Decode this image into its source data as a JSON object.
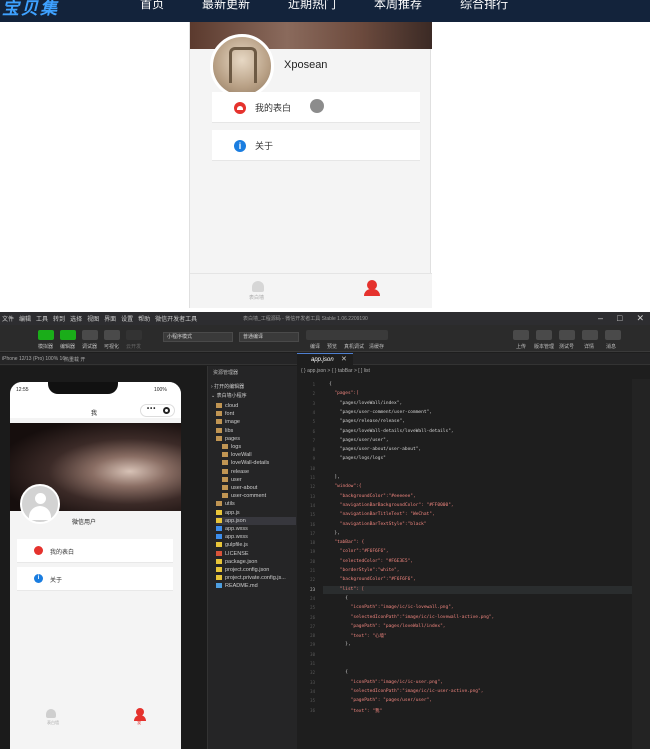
{
  "site": {
    "brand": "宝贝集",
    "nav": [
      "首页",
      "最新更新",
      "近期热门",
      "本周推荐",
      "综合排行"
    ]
  },
  "preview": {
    "username": "Xposean",
    "menu": [
      {
        "label": "我的表白",
        "icon": "heart-icon"
      },
      {
        "label": "关于",
        "icon": "info-icon"
      }
    ],
    "tabs": [
      {
        "label": "表白墙",
        "icon": "heart-tab-icon"
      },
      {
        "label": "我",
        "icon": "user-tab-icon"
      }
    ]
  },
  "devtools": {
    "menu": [
      "文件",
      "编辑",
      "工具",
      "转到",
      "选择",
      "视图",
      "界面",
      "设置",
      "帮助",
      "微信开发者工具"
    ],
    "window_title": "表白墙_工程源码 - 微信开发者工具 Stable 1.06.2209190",
    "toolbar": {
      "left_labels": [
        "模拟器",
        "编辑器",
        "调试器",
        "可视化",
        "云开发"
      ],
      "mode_select": "小程序模式",
      "compile_select": "普通编译",
      "mid_labels": [
        "编译",
        "预览",
        "真机调试",
        "清缓存"
      ],
      "right_labels": [
        "上传",
        "版本管理",
        "测试号",
        "详情",
        "消息"
      ]
    },
    "sub": {
      "device": "iPhone 12/13 (Pro) 100% 16",
      "network": "热重载 开"
    },
    "file_tab": "app.json",
    "breadcrumb": "{ } app.json > { } tabBar > [ ] list",
    "simulator": {
      "time": "12:55",
      "battery": "100%",
      "nav_title": "我",
      "username": "微信用户",
      "menu": [
        "我的表白",
        "关于"
      ],
      "tabs": [
        "表白墙",
        "我"
      ]
    },
    "explorer": {
      "title": "资源管理器",
      "open_editors": "打开的编辑器",
      "project": "表白墙小程序",
      "items": [
        {
          "label": "cloud",
          "depth": 1,
          "kind": "folder"
        },
        {
          "label": "font",
          "depth": 1,
          "kind": "folder"
        },
        {
          "label": "image",
          "depth": 1,
          "kind": "folder"
        },
        {
          "label": "libs",
          "depth": 1,
          "kind": "folder"
        },
        {
          "label": "pages",
          "depth": 1,
          "kind": "folder"
        },
        {
          "label": "logs",
          "depth": 2,
          "kind": "folder"
        },
        {
          "label": "loveWall",
          "depth": 2,
          "kind": "folder"
        },
        {
          "label": "loveWall-details",
          "depth": 2,
          "kind": "folder"
        },
        {
          "label": "release",
          "depth": 2,
          "kind": "folder"
        },
        {
          "label": "user",
          "depth": 2,
          "kind": "folder"
        },
        {
          "label": "user-about",
          "depth": 2,
          "kind": "folder"
        },
        {
          "label": "user-comment",
          "depth": 2,
          "kind": "folder"
        },
        {
          "label": "utils",
          "depth": 1,
          "kind": "folder"
        },
        {
          "label": "app.js",
          "depth": 1,
          "kind": "js"
        },
        {
          "label": "app.json",
          "depth": 1,
          "kind": "json"
        },
        {
          "label": "app.wxss",
          "depth": 1,
          "kind": "wxss"
        },
        {
          "label": "app.wxss",
          "depth": 1,
          "kind": "wxss"
        },
        {
          "label": "gulpfile.js",
          "depth": 1,
          "kind": "js"
        },
        {
          "label": "LICENSE",
          "depth": 1,
          "kind": "file"
        },
        {
          "label": "package.json",
          "depth": 1,
          "kind": "json"
        },
        {
          "label": "project.config.json",
          "depth": 1,
          "kind": "json"
        },
        {
          "label": "project.private.config.js...",
          "depth": 1,
          "kind": "json"
        },
        {
          "label": "README.md",
          "depth": 1,
          "kind": "md"
        }
      ]
    },
    "code": [
      {
        "n": "1",
        "text": "{"
      },
      {
        "n": "2",
        "text": "  \"pages\":["
      },
      {
        "n": "3",
        "text": "    \"pages/loveWall/index\","
      },
      {
        "n": "4",
        "text": "    \"pages/user-comment/user-comment\","
      },
      {
        "n": "5",
        "text": "    \"pages/release/release\","
      },
      {
        "n": "6",
        "text": "    \"pages/loveWall-details/loveWall-details\","
      },
      {
        "n": "7",
        "text": "    \"pages/user/user\","
      },
      {
        "n": "8",
        "text": "    \"pages/user-about/user-about\","
      },
      {
        "n": "9",
        "text": "    \"pages/logs/logs\""
      },
      {
        "n": "10",
        "text": ""
      },
      {
        "n": "11",
        "text": "  ],"
      },
      {
        "n": "12",
        "text": "  \"window\":{"
      },
      {
        "n": "13",
        "text": "    \"backgroundColor\":\"#eeeeee\","
      },
      {
        "n": "14",
        "text": "    \"navigationBarBackgroundColor\": \"#FF0000\","
      },
      {
        "n": "15",
        "text": "    \"navigationBarTitleText\": \"WeChat\","
      },
      {
        "n": "16",
        "text": "    \"navigationBarTextStyle\":\"black\""
      },
      {
        "n": "17",
        "text": "  },"
      },
      {
        "n": "18",
        "text": "  \"tabBar\": {"
      },
      {
        "n": "19",
        "text": "    \"color\":\"#F6F6F6\","
      },
      {
        "n": "20",
        "text": "    \"selectedColor\": \"#F6E3E5\","
      },
      {
        "n": "21",
        "text": "    \"borderStyle\":\"white\","
      },
      {
        "n": "22",
        "text": "    \"backgroundColor\":\"#F6F6F6\","
      },
      {
        "n": "23",
        "text": "    \"list\": ["
      },
      {
        "n": "24",
        "text": "      {"
      },
      {
        "n": "25",
        "text": "        \"iconPath\":\"image/ic/ic-lovewall.png\","
      },
      {
        "n": "26",
        "text": "        \"selectedIconPath\":\"image/ic/ic-lovewall-active.png\","
      },
      {
        "n": "27",
        "text": "        \"pagePath\": \"pages/loveWall/index\","
      },
      {
        "n": "28",
        "text": "        \"text\": \"心墙\""
      },
      {
        "n": "29",
        "text": "      },"
      },
      {
        "n": "30",
        "text": ""
      },
      {
        "n": "31",
        "text": ""
      },
      {
        "n": "32",
        "text": "      {"
      },
      {
        "n": "33",
        "text": "        \"iconPath\":\"image/ic/ic-user.png\","
      },
      {
        "n": "34",
        "text": "        \"selectedIconPath\":\"image/ic/ic-user-active.png\","
      },
      {
        "n": "35",
        "text": "        \"pagePath\": \"pages/user/user\","
      },
      {
        "n": "36",
        "text": "        \"text\": \"我\""
      }
    ],
    "active_line": "23"
  },
  "colors": {
    "nav_bg": "#13233b",
    "accent_red": "#e5322d",
    "accent_blue": "#1a7de0",
    "toolbar_green": "#1aad19"
  }
}
